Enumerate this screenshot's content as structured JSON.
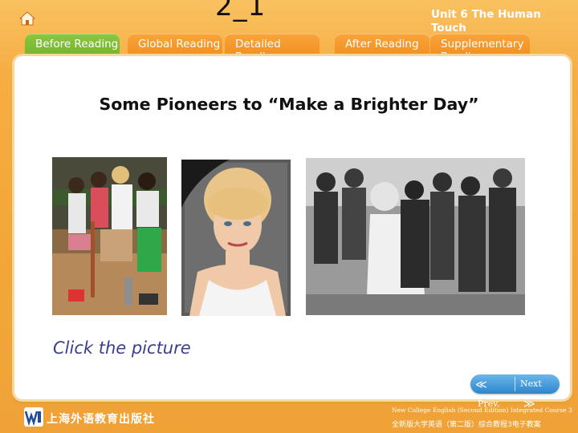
{
  "header": {
    "slide_number": "2_1",
    "unit_title": "Unit 6 The Human Touch",
    "home_icon": "home-icon"
  },
  "tabs": [
    {
      "label": "Before Reading",
      "active": true
    },
    {
      "label": "Global Reading",
      "active": false
    },
    {
      "label": "Detailed Reading",
      "active": false
    },
    {
      "label": "After Reading",
      "active": false
    },
    {
      "label": "Supplementary Reading",
      "active": false
    }
  ],
  "main": {
    "heading": "Some Pioneers to “Make a Brighter Day”",
    "photos": [
      {
        "name": "photo-diana-with-landmine-victims",
        "icon": "photo"
      },
      {
        "name": "photo-diana-portrait",
        "icon": "photo"
      },
      {
        "name": "photo-diana-with-children",
        "icon": "photo"
      }
    ],
    "instruction": "Click the picture"
  },
  "nav": {
    "prev_label": "Prev.",
    "next_label": "Next",
    "prev_icon": "double-chevron-left-icon",
    "next_icon": "double-chevron-right-icon"
  },
  "footer": {
    "publisher_cn": "上海外语教育出版社",
    "course_en": "New College English (Second Edition) Integrated Course 3",
    "course_cn": "全新版大学英语（第二版）综合教程3电子教案"
  },
  "colors": {
    "background": "#f4a93c",
    "active_tab": "#7ab834",
    "tab": "#f39327",
    "nav_button": "#3d94d6",
    "instruction_text": "#3a3e8f"
  }
}
